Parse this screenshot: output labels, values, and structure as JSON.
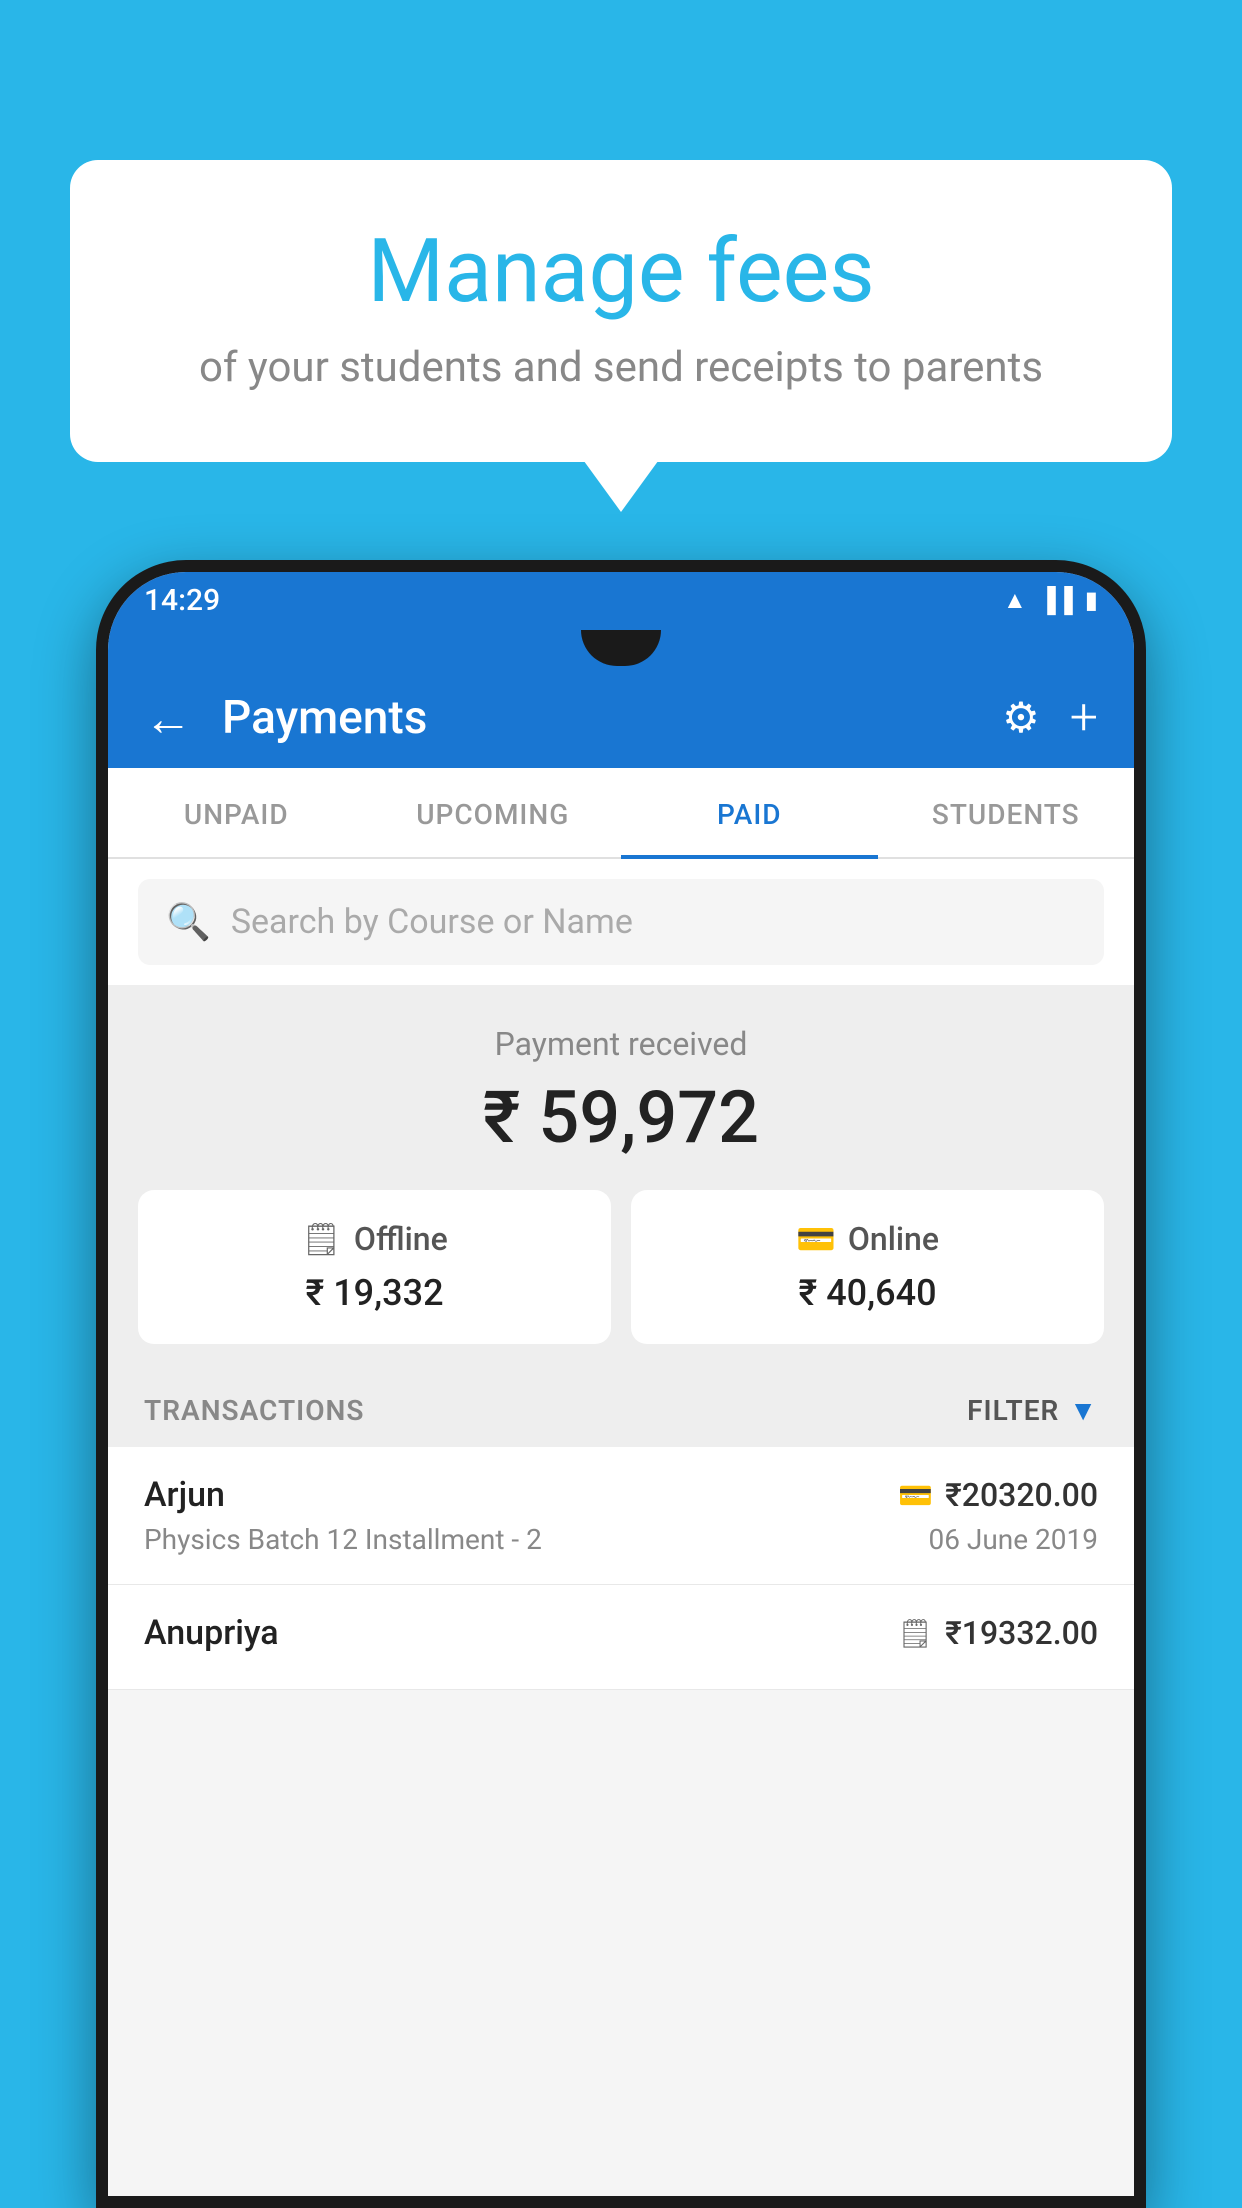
{
  "background_color": "#29b6e8",
  "speech_bubble": {
    "title": "Manage fees",
    "subtitle": "of your students and send receipts to parents"
  },
  "status_bar": {
    "time": "14:29",
    "icons": [
      "wifi",
      "signal",
      "battery"
    ]
  },
  "app_header": {
    "title": "Payments",
    "back_label": "←",
    "gear_label": "⚙",
    "plus_label": "+"
  },
  "tabs": [
    {
      "label": "UNPAID",
      "active": false
    },
    {
      "label": "UPCOMING",
      "active": false
    },
    {
      "label": "PAID",
      "active": true
    },
    {
      "label": "STUDENTS",
      "active": false
    }
  ],
  "search": {
    "placeholder": "Search by Course or Name"
  },
  "payment_summary": {
    "label": "Payment received",
    "total": "₹ 59,972",
    "offline": {
      "type": "Offline",
      "amount": "₹ 19,332"
    },
    "online": {
      "type": "Online",
      "amount": "₹ 40,640"
    }
  },
  "transactions": {
    "label": "TRANSACTIONS",
    "filter_label": "FILTER",
    "items": [
      {
        "name": "Arjun",
        "amount": "₹20320.00",
        "course": "Physics Batch 12 Installment - 2",
        "date": "06 June 2019",
        "icon_type": "card"
      },
      {
        "name": "Anupriya",
        "amount": "₹19332.00",
        "course": "",
        "date": "",
        "icon_type": "rupee"
      }
    ]
  }
}
